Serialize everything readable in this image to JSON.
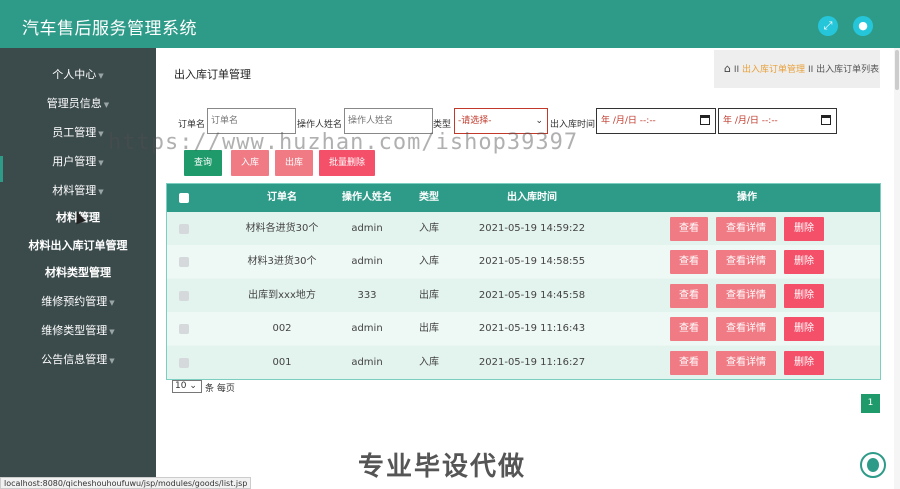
{
  "header": {
    "title": "汽车售后服务管理系统"
  },
  "sidebar": {
    "items": [
      {
        "label": "个人中心"
      },
      {
        "label": "管理员信息"
      },
      {
        "label": "员工管理"
      },
      {
        "label": "用户管理"
      },
      {
        "label": "材料管理"
      },
      {
        "label": "材料管理"
      },
      {
        "label": "材料出入库订单管理"
      },
      {
        "label": "材料类型管理"
      },
      {
        "label": "维修预约管理"
      },
      {
        "label": "维修类型管理"
      },
      {
        "label": "公告信息管理"
      }
    ]
  },
  "page": {
    "heading": "出入库订单管理",
    "breadcrumb": {
      "sep1": "II",
      "item1": "出入库订单管理",
      "sep2": "II",
      "item2": "出入库订单列表"
    }
  },
  "search": {
    "order_label": "订单名",
    "order_placeholder": "订单名",
    "operator_label": "操作人姓名",
    "operator_placeholder": "操作人姓名",
    "type_label": "类型",
    "type_selected": "-请选择-",
    "time_label": "出入库时间",
    "date_placeholder": "年 /月/日 --:--"
  },
  "toolbar": {
    "query": "查询",
    "in": "入库",
    "out": "出库",
    "batch_delete": "批量删除"
  },
  "table": {
    "columns": [
      "订单名",
      "操作人姓名",
      "类型",
      "出入库时间",
      "操作"
    ],
    "rows": [
      {
        "name": "材料各进货30个",
        "operator": "admin",
        "type": "入库",
        "time": "2021-05-19 14:59:22"
      },
      {
        "name": "材料3进货30个",
        "operator": "admin",
        "type": "入库",
        "time": "2021-05-19 14:58:55"
      },
      {
        "name": "出库到xxx地方",
        "operator": "333",
        "type": "出库",
        "time": "2021-05-19 14:45:58"
      },
      {
        "name": "002",
        "operator": "admin",
        "type": "出库",
        "time": "2021-05-19 11:16:43"
      },
      {
        "name": "001",
        "operator": "admin",
        "type": "入库",
        "time": "2021-05-19 11:16:27"
      }
    ],
    "actions": {
      "view": "查看",
      "detail": "查看详情",
      "delete": "删除"
    }
  },
  "pagination": {
    "page_size": "10",
    "page_size_label": "条 每页",
    "current": "1"
  },
  "overlay": {
    "watermark": "https://www.huzhan.com/ishop39397",
    "promo": "专业毕设代做"
  },
  "status_bar": {
    "url": "localhost:8080/qicheshouhoufuwu/jsp/modules/goods/list.jsp"
  },
  "colors": {
    "primary": "#2e9b89",
    "sidebar": "#3b4a4b",
    "pink": "#f07b85",
    "red": "#f4506a",
    "green": "#1f9a6b"
  },
  "icons": [
    "fullscreen-icon",
    "user-icon",
    "home-icon",
    "calendar-icon",
    "back-to-top-icon"
  ]
}
